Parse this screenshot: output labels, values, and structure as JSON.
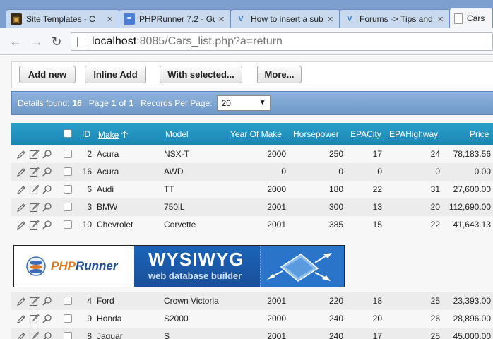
{
  "browser": {
    "tabs": [
      {
        "title": "Site Templates - C",
        "icon": "site-templates-icon"
      },
      {
        "title": "PHPRunner 7.2 - Gu",
        "icon": "document-icon"
      },
      {
        "title": "How to insert a sub",
        "icon": "forum-v-icon"
      },
      {
        "title": "Forums -> Tips and",
        "icon": "forum-v-icon"
      },
      {
        "title": "Cars",
        "icon": "page-icon"
      }
    ],
    "url_host": "localhost",
    "url_path": ":8085/Cars_list.php?a=return"
  },
  "toolbar": {
    "add_new": "Add new",
    "inline_add": "Inline Add",
    "with_selected": "With selected...",
    "more": "More..."
  },
  "info": {
    "details_label": "Details found:",
    "details_count": "16",
    "page_label": "Page",
    "page_current": "1",
    "of_label": "of",
    "page_total": "1",
    "rpp_label": "Records Per Page:",
    "rpp_value": "20"
  },
  "columns": {
    "id": "ID",
    "make": "Make",
    "model": "Model",
    "year": "Year Of Make",
    "hp": "Horsepower",
    "city": "EPACity",
    "highway": "EPAHighway",
    "price": "Price"
  },
  "rows_top": [
    {
      "id": "2",
      "make": "Acura",
      "model": "NSX-T",
      "year": "2000",
      "hp": "250",
      "city": "17",
      "highway": "24",
      "price": "78,183.56"
    },
    {
      "id": "16",
      "make": "Acura",
      "model": "AWD",
      "year": "0",
      "hp": "0",
      "city": "0",
      "highway": "0",
      "price": "0.00"
    },
    {
      "id": "6",
      "make": "Audi",
      "model": "TT",
      "year": "2000",
      "hp": "180",
      "city": "22",
      "highway": "31",
      "price": "27,600.00"
    },
    {
      "id": "3",
      "make": "BMW",
      "model": "750iL",
      "year": "2001",
      "hp": "300",
      "city": "13",
      "highway": "20",
      "price": "112,690.00"
    },
    {
      "id": "10",
      "make": "Chevrolet",
      "model": "Corvette",
      "year": "2001",
      "hp": "385",
      "city": "15",
      "highway": "22",
      "price": "41,643.13"
    }
  ],
  "banner": {
    "php": "PHP",
    "runner": "Runner",
    "headline": "WYSIWYG",
    "subline": "web database builder"
  },
  "rows_bottom": [
    {
      "id": "4",
      "make": "Ford",
      "model": "Crown Victoria",
      "year": "2001",
      "hp": "220",
      "city": "18",
      "highway": "25",
      "price": "23,393.00"
    },
    {
      "id": "9",
      "make": "Honda",
      "model": "S2000",
      "year": "2000",
      "hp": "240",
      "city": "20",
      "highway": "26",
      "price": "28,896.00"
    },
    {
      "id": "8",
      "make": "Jaguar",
      "model": "S",
      "year": "2001",
      "hp": "240",
      "city": "17",
      "highway": "25",
      "price": "45,000.00"
    }
  ],
  "colors": {
    "tabstrip": "#7c9fcf",
    "grid_header": "#1b86b3",
    "infobar": "#6f98c9"
  }
}
